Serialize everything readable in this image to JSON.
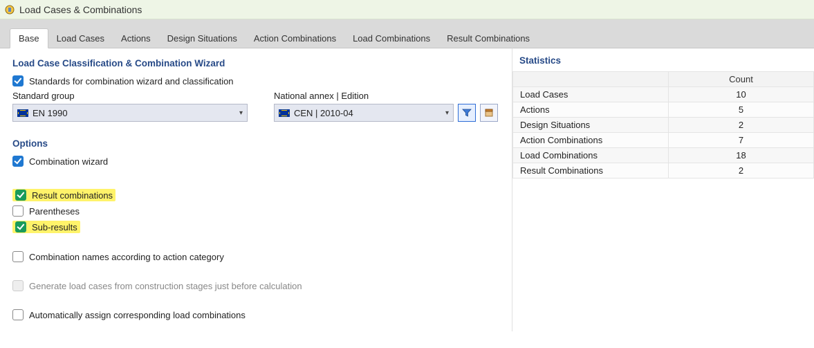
{
  "window": {
    "title": "Load Cases & Combinations"
  },
  "tabs": [
    {
      "label": "Base",
      "active": true
    },
    {
      "label": "Load Cases"
    },
    {
      "label": "Actions"
    },
    {
      "label": "Design Situations"
    },
    {
      "label": "Action Combinations"
    },
    {
      "label": "Load Combinations"
    },
    {
      "label": "Result Combinations"
    }
  ],
  "wizard": {
    "heading": "Load Case Classification & Combination Wizard",
    "standards_label": "Standards for combination wizard and classification",
    "group_label": "Standard group",
    "group_value": "EN 1990",
    "annex_label": "National annex | Edition",
    "annex_value": "CEN | 2010-04"
  },
  "options": {
    "heading": "Options",
    "combination_wizard": "Combination wizard",
    "result_combinations": "Result combinations",
    "parentheses": "Parentheses",
    "sub_results": "Sub-results",
    "names_by_category": "Combination names according to action category",
    "gen_from_stages": "Generate load cases from construction stages just before calculation",
    "auto_assign": "Automatically assign corresponding load combinations"
  },
  "stats": {
    "heading": "Statistics",
    "count_header": "Count",
    "rows": [
      {
        "label": "Load Cases",
        "count": "10"
      },
      {
        "label": "Actions",
        "count": "5"
      },
      {
        "label": "Design Situations",
        "count": "2"
      },
      {
        "label": "Action Combinations",
        "count": "7"
      },
      {
        "label": "Load Combinations",
        "count": "18"
      },
      {
        "label": "Result Combinations",
        "count": "2"
      }
    ]
  }
}
